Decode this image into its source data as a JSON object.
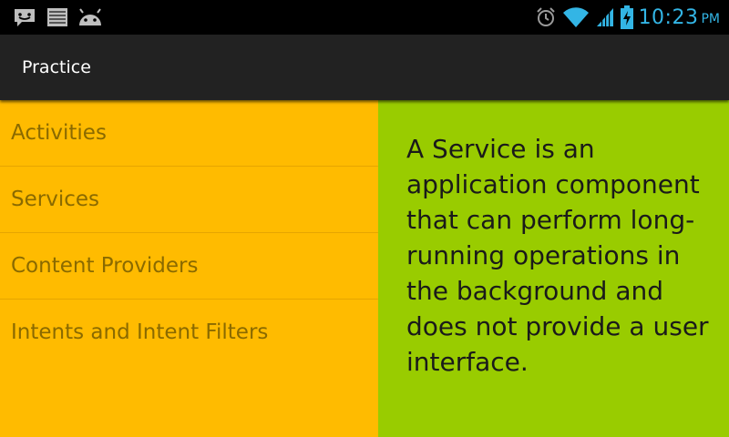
{
  "status_bar": {
    "notification_icons": [
      "message-icon",
      "news-icon",
      "android-icon"
    ],
    "status_icons": [
      "alarm-icon",
      "wifi-icon",
      "signal-icon",
      "battery-charging-icon"
    ],
    "time": "10:23",
    "ampm": "PM"
  },
  "action_bar": {
    "title": "Practice"
  },
  "list": {
    "items": [
      {
        "label": "Activities"
      },
      {
        "label": "Services"
      },
      {
        "label": "Content Providers"
      },
      {
        "label": "Intents and Intent Filters"
      }
    ]
  },
  "detail": {
    "text": "A Service is an application component that can perform long-running operations in the background and does not provide a user interface."
  },
  "colors": {
    "status_accent": "#33b5e5",
    "action_bar": "#222222",
    "list_background": "#ffbb00",
    "detail_background": "#99cc00"
  }
}
